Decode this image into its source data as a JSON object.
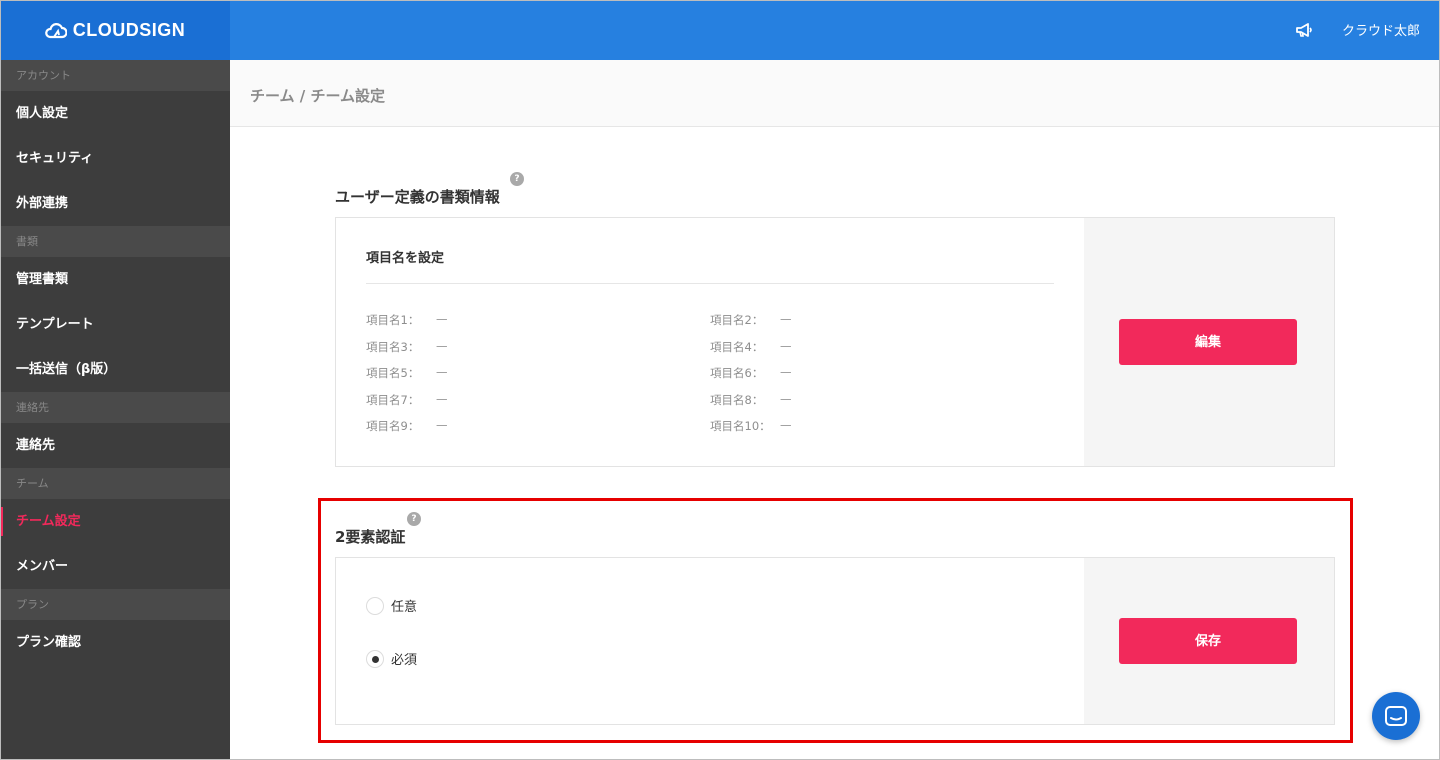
{
  "brand": {
    "name": "CLOUDSIGN"
  },
  "header": {
    "user_name": "クラウド太郎",
    "announce_icon": "megaphone-icon"
  },
  "sidebar": {
    "sections": [
      {
        "label": "アカウント",
        "items": [
          "個人設定",
          "セキュリティ",
          "外部連携"
        ]
      },
      {
        "label": "書類",
        "items": [
          "管理書類",
          "テンプレート",
          "一括送信（β版）"
        ]
      },
      {
        "label": "連絡先",
        "items": [
          "連絡先"
        ]
      },
      {
        "label": "チーム",
        "items": [
          "チーム設定",
          "メンバー"
        ]
      },
      {
        "label": "プラン",
        "items": [
          "プラン確認"
        ]
      }
    ],
    "active_item": "チーム設定"
  },
  "breadcrumb": "チーム / チーム設定",
  "custom_fields": {
    "title": "ユーザー定義の書類情報",
    "help": "?",
    "subheading": "項目名を設定",
    "fields": [
      {
        "label": "項目名1：",
        "value": "—"
      },
      {
        "label": "項目名2：",
        "value": "—"
      },
      {
        "label": "項目名3：",
        "value": "—"
      },
      {
        "label": "項目名4：",
        "value": "—"
      },
      {
        "label": "項目名5：",
        "value": "—"
      },
      {
        "label": "項目名6：",
        "value": "—"
      },
      {
        "label": "項目名7：",
        "value": "—"
      },
      {
        "label": "項目名8：",
        "value": "—"
      },
      {
        "label": "項目名9：",
        "value": "—"
      },
      {
        "label": "項目名10：",
        "value": "—"
      }
    ],
    "edit_label": "編集"
  },
  "two_factor": {
    "title": "2要素認証",
    "help": "?",
    "options": [
      {
        "label": "任意",
        "selected": false
      },
      {
        "label": "必須",
        "selected": true
      }
    ],
    "save_label": "保存"
  },
  "colors": {
    "accent": "#f2295b",
    "header_blue": "#2680e0",
    "logo_blue": "#1a6fd4",
    "sidebar_bg": "#3d3d3d",
    "highlight": "#e60000"
  }
}
